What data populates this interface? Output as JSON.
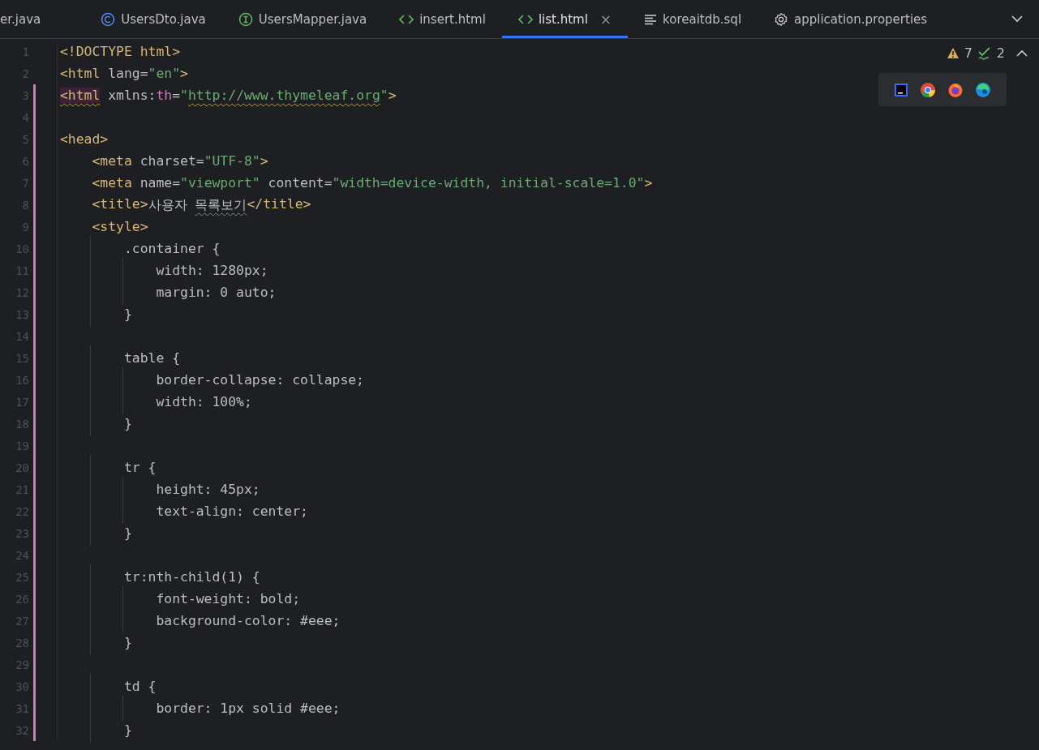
{
  "tabs": [
    {
      "label": "er.java",
      "kind": "plain",
      "selected": false
    },
    {
      "label": "UsersDto.java",
      "kind": "class",
      "selected": false
    },
    {
      "label": "UsersMapper.java",
      "kind": "interface",
      "selected": false
    },
    {
      "label": "insert.html",
      "kind": "html",
      "selected": false
    },
    {
      "label": "list.html",
      "kind": "html",
      "selected": true,
      "close": "×"
    },
    {
      "label": "koreaitdb.sql",
      "kind": "sql",
      "selected": false
    },
    {
      "label": "application.properties",
      "kind": "properties",
      "selected": false
    }
  ],
  "inspections": {
    "warnings": "7",
    "weak_warnings": "2"
  },
  "lines": [
    {
      "number": "1",
      "changed": false,
      "tokens": [
        {
          "kind": "tag",
          "t": "<!DOCTYPE html>"
        }
      ]
    },
    {
      "number": "2",
      "changed": false,
      "tokens": [
        {
          "kind": "tag",
          "t": "<html"
        },
        {
          "kind": "plain",
          "t": " lang="
        },
        {
          "kind": "string",
          "t": "\"en\""
        },
        {
          "kind": "tag",
          "t": ">"
        }
      ]
    },
    {
      "number": "3",
      "changed": true,
      "tokens": [
        {
          "kind": "error",
          "t": "<html"
        },
        {
          "kind": "plain",
          "t": " xmlns:"
        },
        {
          "kind": "namespace",
          "t": "th"
        },
        {
          "kind": "plain",
          "t": "="
        },
        {
          "kind": "string",
          "t": "\""
        },
        {
          "kind": "warning",
          "t": "http://www.thymeleaf.org"
        },
        {
          "kind": "string",
          "t": "\""
        },
        {
          "kind": "tag",
          "t": ">"
        }
      ]
    },
    {
      "number": "4",
      "changed": true
    },
    {
      "number": "5",
      "changed": true,
      "tokens": [
        {
          "kind": "tag",
          "t": "<head>"
        }
      ]
    },
    {
      "number": "6",
      "changed": true,
      "tokens": [
        {
          "kind": "tag",
          "t": "    <meta"
        },
        {
          "kind": "plain",
          "t": " charset="
        },
        {
          "kind": "string",
          "t": "\"UTF-8\""
        },
        {
          "kind": "tag",
          "t": ">"
        }
      ]
    },
    {
      "number": "7",
      "changed": true,
      "tokens": [
        {
          "kind": "tag",
          "t": "    <meta"
        },
        {
          "kind": "plain",
          "t": " name="
        },
        {
          "kind": "string",
          "t": "\"viewport\""
        },
        {
          "kind": "plain",
          "t": " content="
        },
        {
          "kind": "string",
          "t": "\"width=device-width, initial-scale=1.0\""
        },
        {
          "kind": "tag",
          "t": ">"
        }
      ]
    },
    {
      "number": "8",
      "changed": true,
      "tokens": [
        {
          "kind": "tag",
          "t": "    <title>"
        },
        {
          "kind": "plain",
          "t": "사용자 "
        },
        {
          "kind": "typo",
          "t": "목록보기"
        },
        {
          "kind": "tag",
          "t": "</title>"
        }
      ]
    },
    {
      "number": "9",
      "changed": true,
      "tokens": [
        {
          "kind": "tag",
          "t": "    <style>"
        }
      ]
    },
    {
      "number": "10",
      "changed": true,
      "tokens": [
        {
          "kind": "plain",
          "t": "        .container {"
        }
      ]
    },
    {
      "number": "11",
      "changed": true,
      "tokens": [
        {
          "kind": "plain",
          "t": "            width: 1280px;"
        }
      ]
    },
    {
      "number": "12",
      "changed": true,
      "tokens": [
        {
          "kind": "plain",
          "t": "            margin: 0 auto;"
        }
      ]
    },
    {
      "number": "13",
      "changed": true,
      "tokens": [
        {
          "kind": "plain",
          "t": "        }"
        }
      ]
    },
    {
      "number": "14",
      "changed": true
    },
    {
      "number": "15",
      "changed": true,
      "tokens": [
        {
          "kind": "plain",
          "t": "        table {"
        }
      ]
    },
    {
      "number": "16",
      "changed": true,
      "tokens": [
        {
          "kind": "plain",
          "t": "            border-collapse: collapse;"
        }
      ]
    },
    {
      "number": "17",
      "changed": true,
      "tokens": [
        {
          "kind": "plain",
          "t": "            width: 100%;"
        }
      ]
    },
    {
      "number": "18",
      "changed": true,
      "tokens": [
        {
          "kind": "plain",
          "t": "        }"
        }
      ]
    },
    {
      "number": "19",
      "changed": true
    },
    {
      "number": "20",
      "changed": true,
      "tokens": [
        {
          "kind": "plain",
          "t": "        tr {"
        }
      ]
    },
    {
      "number": "21",
      "changed": true,
      "tokens": [
        {
          "kind": "plain",
          "t": "            height: 45px;"
        }
      ]
    },
    {
      "number": "22",
      "changed": true,
      "tokens": [
        {
          "kind": "plain",
          "t": "            text-align: center;"
        }
      ]
    },
    {
      "number": "23",
      "changed": true,
      "tokens": [
        {
          "kind": "plain",
          "t": "        }"
        }
      ]
    },
    {
      "number": "24",
      "changed": true
    },
    {
      "number": "25",
      "changed": true,
      "tokens": [
        {
          "kind": "plain",
          "t": "        tr:nth-child(1) {"
        }
      ]
    },
    {
      "number": "26",
      "changed": true,
      "tokens": [
        {
          "kind": "plain",
          "t": "            font-weight: bold;"
        }
      ]
    },
    {
      "number": "27",
      "changed": true,
      "tokens": [
        {
          "kind": "plain",
          "t": "            background-color: #eee;"
        }
      ]
    },
    {
      "number": "28",
      "changed": true,
      "tokens": [
        {
          "kind": "plain",
          "t": "        }"
        }
      ]
    },
    {
      "number": "29",
      "changed": true
    },
    {
      "number": "30",
      "changed": true,
      "tokens": [
        {
          "kind": "plain",
          "t": "        td {"
        }
      ]
    },
    {
      "number": "31",
      "changed": true,
      "tokens": [
        {
          "kind": "plain",
          "t": "            border: 1px solid #eee;"
        }
      ]
    },
    {
      "number": "32",
      "changed": true,
      "tokens": [
        {
          "kind": "plain",
          "t": "        }"
        }
      ]
    }
  ]
}
